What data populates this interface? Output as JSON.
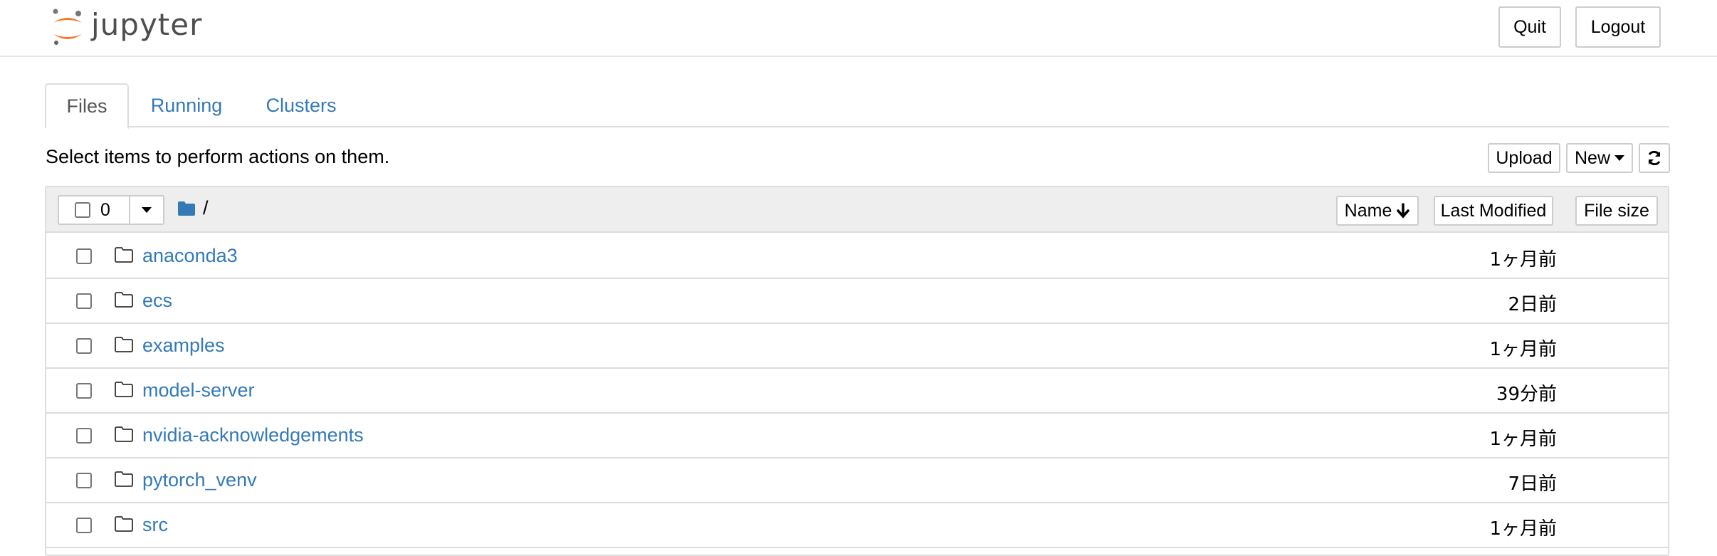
{
  "header": {
    "logo_text": "jupyter",
    "quit_label": "Quit",
    "logout_label": "Logout"
  },
  "tabs": [
    {
      "label": "Files",
      "active": true
    },
    {
      "label": "Running",
      "active": false
    },
    {
      "label": "Clusters",
      "active": false
    }
  ],
  "toolbar": {
    "instruction": "Select items to perform actions on them.",
    "upload_label": "Upload",
    "new_label": "New",
    "refresh_icon": "refresh-icon"
  },
  "list_header": {
    "selected_count": "0",
    "path": "/",
    "sort_name_label": "Name",
    "sort_modified_label": "Last Modified",
    "sort_size_label": "File size"
  },
  "files": [
    {
      "name": "anaconda3",
      "modified": "1ヶ月前",
      "type": "folder"
    },
    {
      "name": "ecs",
      "modified": "2日前",
      "type": "folder"
    },
    {
      "name": "examples",
      "modified": "1ヶ月前",
      "type": "folder"
    },
    {
      "name": "model-server",
      "modified": "39分前",
      "type": "folder"
    },
    {
      "name": "nvidia-acknowledgements",
      "modified": "1ヶ月前",
      "type": "folder"
    },
    {
      "name": "pytorch_venv",
      "modified": "7日前",
      "type": "folder"
    },
    {
      "name": "src",
      "modified": "1ヶ月前",
      "type": "folder"
    }
  ],
  "colors": {
    "link": "#337ab7",
    "border": "#dddddd",
    "header_bg": "#eeeeee",
    "logo_orange": "#f37726"
  }
}
